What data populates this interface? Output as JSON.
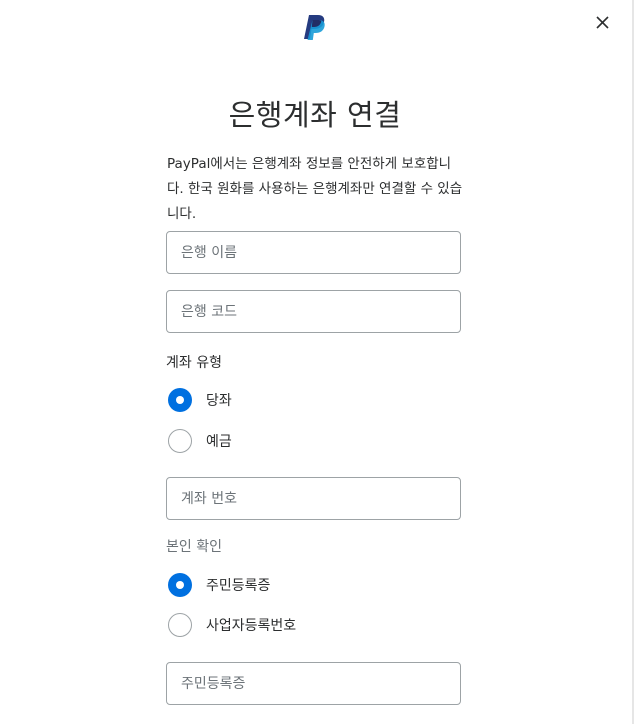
{
  "header": {
    "logo_icon": "paypal-logo-icon",
    "close_icon": "close-icon"
  },
  "dialog": {
    "title": "은행계좌 연결",
    "description": "PayPal에서는 은행계좌 정보를 안전하게 보호합니다. 한국 원화를 사용하는 은행계좌만 연결할 수 있습니다."
  },
  "form": {
    "bank_name": {
      "placeholder": "은행 이름",
      "value": ""
    },
    "bank_code": {
      "placeholder": "은행 코드",
      "value": ""
    },
    "account_type": {
      "label": "계좌 유형",
      "options": [
        {
          "label": "당좌",
          "selected": true
        },
        {
          "label": "예금",
          "selected": false
        }
      ]
    },
    "account_number": {
      "placeholder": "계좌 번호",
      "value": ""
    },
    "identity": {
      "label": "본인 확인",
      "options": [
        {
          "label": "주민등록증",
          "selected": true
        },
        {
          "label": "사업자등록번호",
          "selected": false
        }
      ]
    },
    "id_number": {
      "placeholder": "주민등록증",
      "value": ""
    }
  },
  "colors": {
    "accent": "#0070e0",
    "brand_dark": "#253b80",
    "brand_light": "#179bd7",
    "border": "#9da3a6",
    "muted_text": "#6c7378"
  }
}
